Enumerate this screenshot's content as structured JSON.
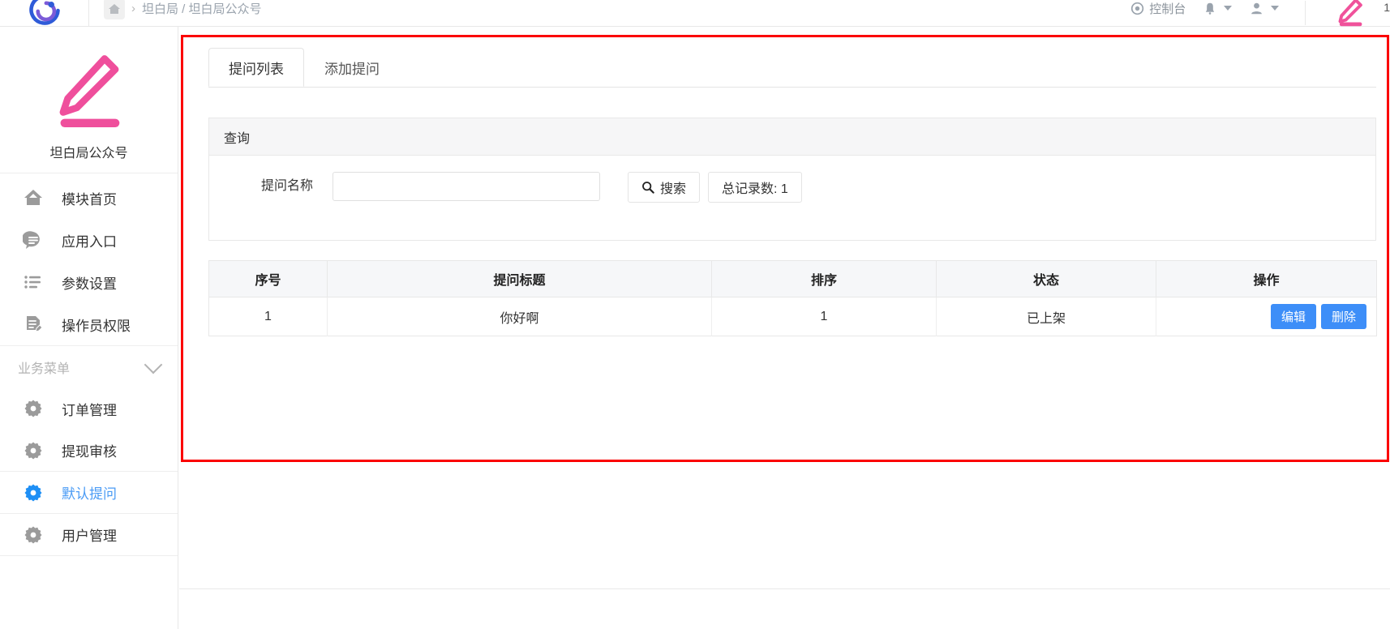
{
  "header": {
    "logo_icon": "spiral-logo-icon",
    "home_icon": "home-icon",
    "breadcrumb_separator": "›",
    "breadcrumb": "坦白局 / 坦白局公众号",
    "console_icon": "target-icon",
    "console_label": "控制台",
    "bell_icon": "bell-icon",
    "user_icon": "user-icon",
    "brand_pencil_icon": "pencil-icon"
  },
  "sidebar": {
    "brand_icon": "pencil-underline-icon",
    "brand_name": "坦白局公众号",
    "items": [
      {
        "label": "模块首页",
        "icon": "home-icon",
        "active": false
      },
      {
        "label": "应用入口",
        "icon": "chat-bubble-icon",
        "active": false
      },
      {
        "label": "参数设置",
        "icon": "list-settings-icon",
        "active": false
      },
      {
        "label": "操作员权限",
        "icon": "document-edit-icon",
        "active": false
      }
    ],
    "group": {
      "title": "业务菜单",
      "chevron_icon": "chevron-down-icon",
      "items": [
        {
          "label": "订单管理",
          "icon": "gear-icon",
          "active": false
        },
        {
          "label": "提现审核",
          "icon": "gear-icon",
          "active": false
        },
        {
          "label": "默认提问",
          "icon": "gear-icon",
          "active": true
        },
        {
          "label": "用户管理",
          "icon": "gear-icon",
          "active": false
        }
      ]
    },
    "active_color": "#4a9bf5"
  },
  "main": {
    "tabs": [
      {
        "label": "提问列表",
        "active": true
      },
      {
        "label": "添加提问",
        "active": false
      }
    ],
    "query": {
      "panel_title": "查询",
      "field_label": "提问名称",
      "field_value": "",
      "field_placeholder": "",
      "search_icon": "search-icon",
      "search_label": "搜索",
      "count_label": "总记录数: 1"
    },
    "table": {
      "columns": [
        "序号",
        "提问标题",
        "排序",
        "状态",
        "操作"
      ],
      "rows": [
        {
          "index": "1",
          "title": "你好啊",
          "sort": "1",
          "status": "已上架",
          "edit_label": "编辑",
          "delete_label": "删除"
        }
      ]
    },
    "highlight_color": "#fb0000",
    "button_color": "#3d8ef8"
  }
}
